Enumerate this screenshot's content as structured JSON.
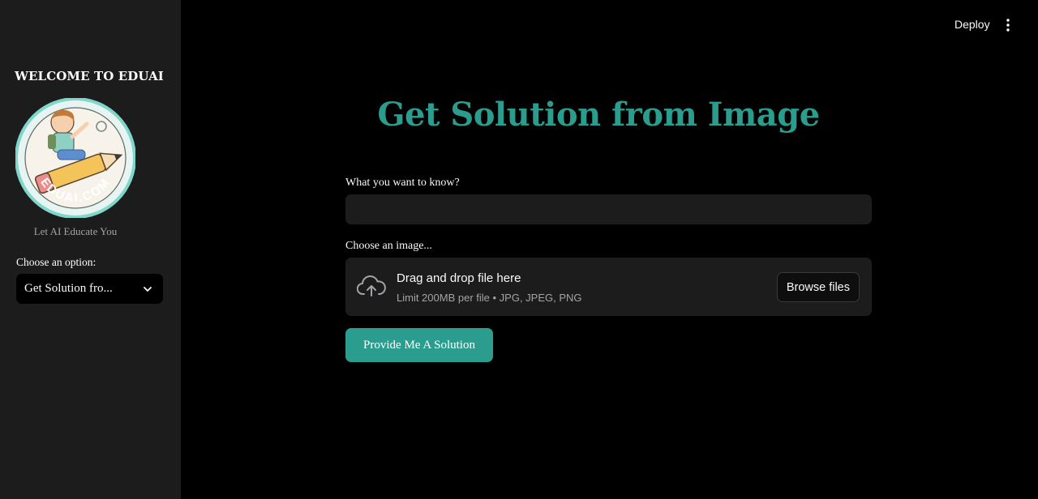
{
  "sidebar": {
    "title": "WELCOME TO EDUAI",
    "logo_text": "EDUAI.COM",
    "tagline": "Let AI Educate You",
    "select_label": "Choose an option:",
    "select_value": "Get Solution fro..."
  },
  "header": {
    "deploy_label": "Deploy",
    "menu_icon": "kebab-menu-icon"
  },
  "main": {
    "title": "Get Solution from Image",
    "question_label": "What you want to know?",
    "question_value": "",
    "image_label": "Choose an image...",
    "dropzone": {
      "title": "Drag and drop file here",
      "subtitle": "Limit 200MB per file • JPG, JPEG, PNG",
      "browse_label": "Browse files",
      "icon": "cloud-upload-icon"
    },
    "submit_label": "Provide Me A Solution"
  },
  "colors": {
    "accent": "#2a9d8f",
    "background": "#000000",
    "sidebar": "#1c1c1c"
  }
}
